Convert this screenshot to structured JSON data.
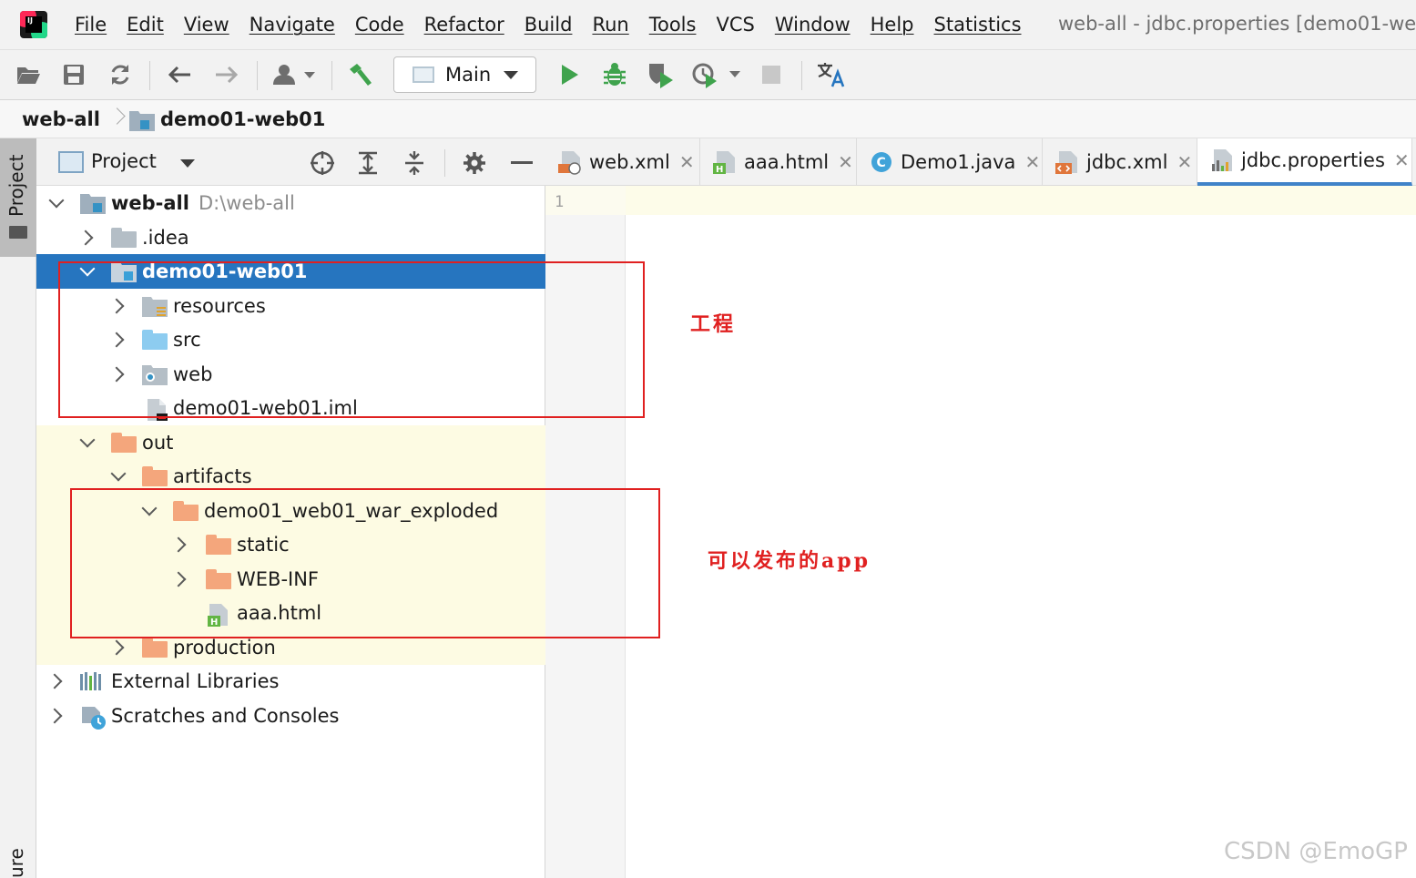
{
  "menubar": {
    "items": [
      "File",
      "Edit",
      "View",
      "Navigate",
      "Code",
      "Refactor",
      "Build",
      "Run",
      "Tools",
      "VCS",
      "Window",
      "Help",
      "Statistics"
    ],
    "window_title": "web-all - jdbc.properties [demo01-web"
  },
  "toolbar": {
    "run_config": "Main"
  },
  "breadcrumb": {
    "root": "web-all",
    "module": "demo01-web01"
  },
  "tool_strip": {
    "project_tab": "Project",
    "bottom_tab": "ure"
  },
  "project_panel": {
    "title": "Project",
    "tree": {
      "root_name": "web-all",
      "root_path": "D:\\web-all",
      "idea": ".idea",
      "module": "demo01-web01",
      "resources": "resources",
      "src": "src",
      "web": "web",
      "iml": "demo01-web01.iml",
      "out": "out",
      "artifacts": "artifacts",
      "exploded": "demo01_web01_war_exploded",
      "static": "static",
      "webinf": "WEB-INF",
      "aaa": "aaa.html",
      "production": "production",
      "external": "External Libraries",
      "scratches": "Scratches and Consoles"
    }
  },
  "editor_tabs": [
    {
      "label": "web.xml"
    },
    {
      "label": "aaa.html"
    },
    {
      "label": "Demo1.java",
      "icon_letter": "C"
    },
    {
      "label": "jdbc.xml"
    },
    {
      "label": "jdbc.properties"
    }
  ],
  "editor": {
    "line_number": "1"
  },
  "annotations": {
    "project_label": "工程",
    "app_label": "可以发布的app"
  },
  "watermark": "CSDN @EmoGP",
  "colors": {
    "selection": "#2675bf",
    "excluded_bg": "#fdfbe3",
    "annotation": "#e02020",
    "run_green": "#3fa34d"
  }
}
